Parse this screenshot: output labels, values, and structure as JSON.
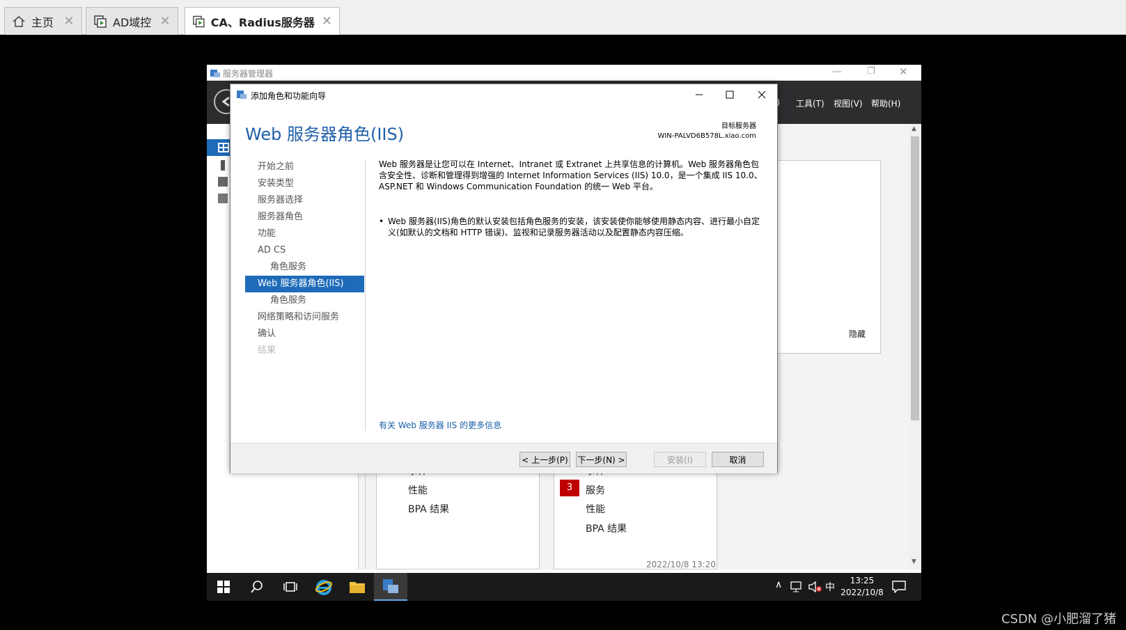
{
  "vm_tabs": [
    {
      "label": "主页",
      "icon": "home-icon"
    },
    {
      "label": "AD域控",
      "icon": "vm-icon"
    },
    {
      "label": "CA、Radius服务器",
      "icon": "vm-icon"
    }
  ],
  "server_manager": {
    "title": "服务器管理器",
    "menu": {
      "manage": "M)",
      "tools": "工具(T)",
      "view": "视图(V)",
      "help": "帮助(H)"
    },
    "hide_link": "隐藏",
    "tile_left": {
      "items": [
        "事件",
        "性能",
        "BPA 结果"
      ]
    },
    "tile_right": {
      "badge": "3",
      "items": [
        "事件",
        "服务",
        "性能",
        "BPA 结果"
      ],
      "timestamp": "2022/10/8 13:20"
    }
  },
  "taskbar": {
    "time": "13:25",
    "date": "2022/10/8",
    "ime": "中"
  },
  "wizard": {
    "title": "添加角色和功能向导",
    "heading": "Web 服务器角色(IIS)",
    "target_label": "目标服务器",
    "target_server": "WIN-PALVD6B578L.xiao.com",
    "nav": [
      {
        "label": "开始之前"
      },
      {
        "label": "安装类型"
      },
      {
        "label": "服务器选择"
      },
      {
        "label": "服务器角色"
      },
      {
        "label": "功能"
      },
      {
        "label": "AD CS"
      },
      {
        "label": "角色服务"
      },
      {
        "label": "Web 服务器角色(IIS)"
      },
      {
        "label": "角色服务"
      },
      {
        "label": "网络策略和访问服务"
      },
      {
        "label": "确认"
      },
      {
        "label": "结果"
      }
    ],
    "description": "Web 服务器是让您可以在 Internet、Intranet 或 Extranet 上共享信息的计算机。Web 服务器角色包含安全性、诊断和管理得到增强的 Internet Information Services (IIS) 10.0，是一个集成 IIS 10.0、ASP.NET 和 Windows Communication Foundation 的统一 Web 平台。",
    "bullet": "Web 服务器(IIS)角色的默认安装包括角色服务的安装，该安装使你能够使用静态内容、进行最小自定义(如默认的文档和 HTTP 错误)、监视和记录服务器活动以及配置静态内容压缩。",
    "more_link": "有关 Web 服务器 IIS 的更多信息",
    "buttons": {
      "prev": "< 上一步(P)",
      "next": "下一步(N) >",
      "install": "安装(I)",
      "cancel": "取消"
    }
  },
  "watermark": "CSDN @小肥溜了猪"
}
